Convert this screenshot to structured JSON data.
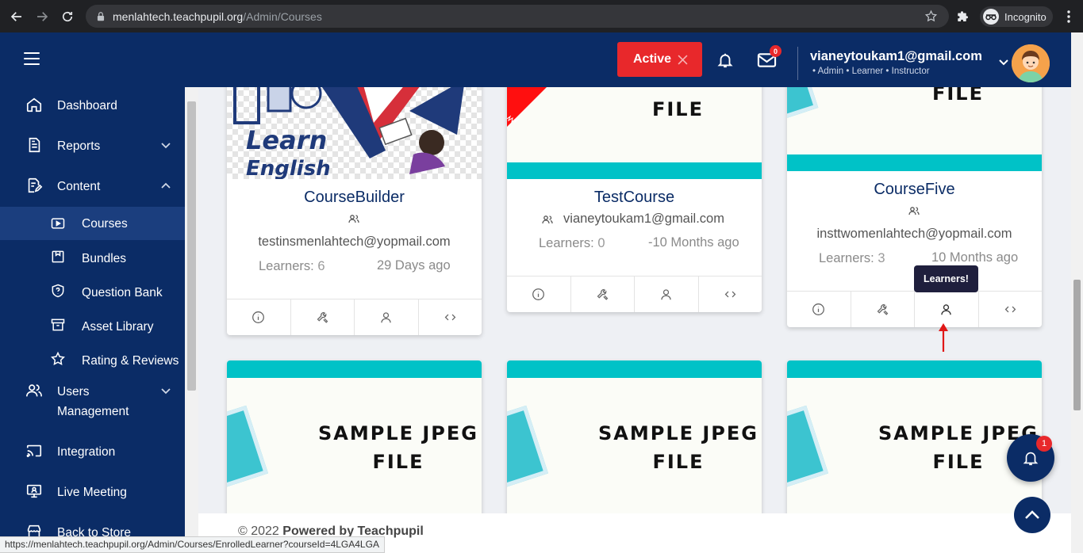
{
  "browser": {
    "url_host": "menlahtech.teachpupil.org",
    "url_path": "/Admin/Courses",
    "incognito_label": "Incognito",
    "status_url": "https://menlahtech.teachpupil.org/Admin/Courses/EnrolledLearner?courseId=4LGA4LGA"
  },
  "header": {
    "active_label": "Active",
    "mail_badge": "0",
    "user_email": "vianeytoukam1@gmail.com",
    "user_roles": "• Admin • Learner • Instructor",
    "accent": "#0b2c66",
    "danger": "#e8282b"
  },
  "sidebar": {
    "items": [
      {
        "label": "Dashboard",
        "icon": "home-icon"
      },
      {
        "label": "Reports",
        "icon": "report-icon"
      },
      {
        "label": "Content",
        "icon": "content-edit-icon"
      },
      {
        "label": "Courses",
        "icon": "play-video-icon"
      },
      {
        "label": "Bundles",
        "icon": "bundle-icon"
      },
      {
        "label": "Question Bank",
        "icon": "shield-question-icon"
      },
      {
        "label": "Asset Library",
        "icon": "archive-icon"
      },
      {
        "label": "Rating & Reviews",
        "icon": "star-icon"
      },
      {
        "label": "Users",
        "label2": "Management",
        "icon": "users-icon"
      },
      {
        "label": "Integration",
        "icon": "cast-icon"
      },
      {
        "label": "Live Meeting",
        "icon": "presentation-icon"
      },
      {
        "label": "Back to Store",
        "icon": "store-icon"
      }
    ]
  },
  "courses": [
    {
      "title": "CourseBuilder",
      "email": "testinsmenlahtech@yopmail.com",
      "learners_label": "Learners:",
      "learners": "6",
      "age": "29 Days ago",
      "thumb_text_1": "Learn",
      "thumb_text_2": "English"
    },
    {
      "title": "TestCourse",
      "email": "vianeytoukam1@gmail.com",
      "learners_label": "Learners:",
      "learners": "0",
      "age": "-10 Months ago",
      "thumb_text": "FILE"
    },
    {
      "title": "CourseFive",
      "email": "insttwomenlahtech@yopmail.com",
      "learners_label": "Learners:",
      "learners": "3",
      "age": "10 Months ago",
      "thumb_text": "FILE"
    }
  ],
  "sample_cards": [
    {
      "line1": "SAMPLE JPEG",
      "line2": "FILE"
    },
    {
      "line1": "SAMPLE JPEG",
      "line2": "FILE"
    },
    {
      "line1": "SAMPLE JPEG",
      "line2": "FILE"
    }
  ],
  "tooltip": "Learners!",
  "footer": {
    "prefix": "© 2022 ",
    "brand": "Powered by Teachpupil"
  },
  "float_badge": "1"
}
